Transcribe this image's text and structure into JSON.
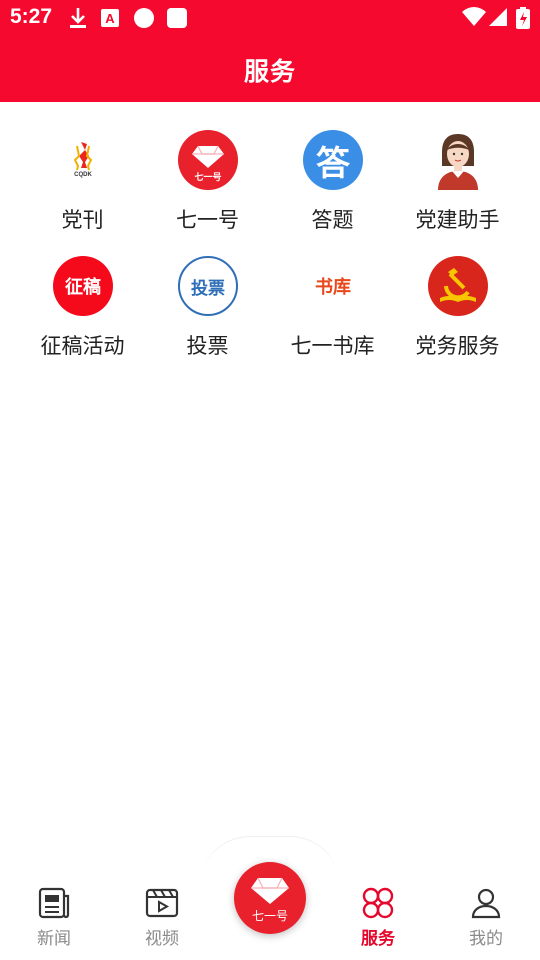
{
  "status_bar": {
    "time": "5:27",
    "colors": {
      "bar": "#f5092e"
    }
  },
  "app_bar": {
    "title": "服务"
  },
  "services": [
    {
      "label": "党刊",
      "icon": "cqdk-logo-icon",
      "logo_text": "CQDK"
    },
    {
      "label": "七一号",
      "icon": "gem-icon",
      "logo_text": "七一号"
    },
    {
      "label": "答题",
      "icon": "answer-icon",
      "logo_text": "答"
    },
    {
      "label": "党建助手",
      "icon": "assistant-avatar-icon"
    },
    {
      "label": "征稿活动",
      "icon": "submission-icon",
      "logo_text": "征稿"
    },
    {
      "label": "投票",
      "icon": "vote-icon",
      "logo_text": "投票"
    },
    {
      "label": "七一书库",
      "icon": "library-icon",
      "logo_text": "书库"
    },
    {
      "label": "党务服务",
      "icon": "party-emblem-icon"
    }
  ],
  "bottom_nav": {
    "items": [
      {
        "label": "新闻",
        "icon": "news-icon",
        "active": false
      },
      {
        "label": "视频",
        "icon": "video-icon",
        "active": false
      },
      {
        "label": "服务",
        "icon": "service-grid-icon",
        "active": true
      },
      {
        "label": "我的",
        "icon": "profile-icon",
        "active": false
      }
    ],
    "center": {
      "label": "七一号",
      "icon": "gem-icon"
    }
  },
  "colors": {
    "brand_red": "#f5092e",
    "active_nav": "#e5072c",
    "answer_blue": "#3a8ee6",
    "vote_blue": "#2f6fb8",
    "library_orange": "#e8481c"
  }
}
